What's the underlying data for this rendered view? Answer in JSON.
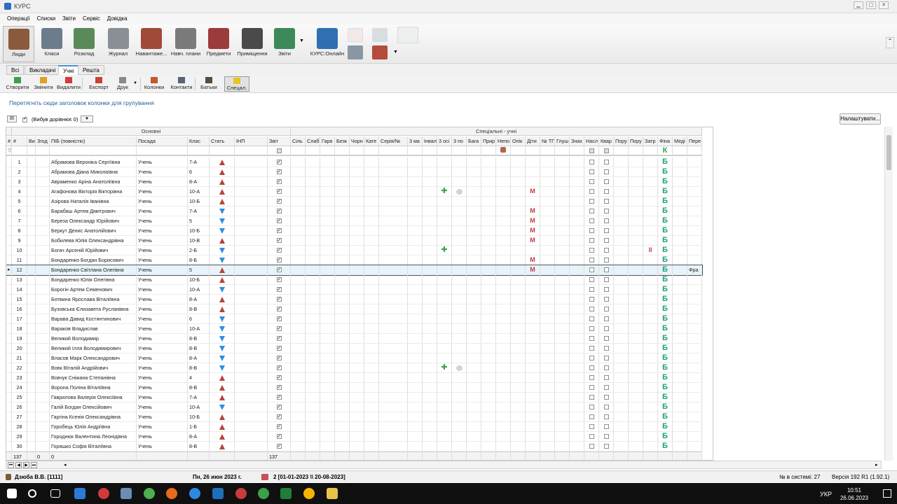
{
  "app": {
    "title": "КУРС"
  },
  "menu": [
    "Операції",
    "Списки",
    "Звіти",
    "Сервіс",
    "Довідка"
  ],
  "ribbon": {
    "buttons": [
      {
        "label": "Люди",
        "icon": "people-icon",
        "color": "#8a5a3c"
      },
      {
        "label": "Класи",
        "icon": "classroom-icon",
        "color": "#6c7c8c"
      },
      {
        "label": "Розклад",
        "icon": "schedule-icon",
        "color": "#5a8a5a"
      },
      {
        "label": "Журнал",
        "icon": "journal-icon",
        "color": "#8a8f96"
      },
      {
        "label": "Навантаже...",
        "icon": "calendar-icon",
        "color": "#a04a3a"
      },
      {
        "label": "Навч. плани",
        "icon": "plans-icon",
        "color": "#7a7a7a"
      },
      {
        "label": "Предмети",
        "icon": "book-icon",
        "color": "#9c3b3b"
      },
      {
        "label": "Приміщення",
        "icon": "building-icon",
        "color": "#4a4a4a"
      },
      {
        "label": "Звіти",
        "icon": "chart-icon",
        "color": "#3c8a5a"
      },
      {
        "label": "КУРС:Онлайн",
        "icon": "globe-icon",
        "color": "#2f6fb2"
      }
    ]
  },
  "tabs": [
    "Всі",
    "Викладачі",
    "Учні",
    "Решта"
  ],
  "active_tab": "Учні",
  "toolbar": {
    "buttons": [
      "Створити",
      "Змінити",
      "Видалити",
      "Експорт",
      "Друк",
      "Колонки",
      "Контакти",
      "Батьки",
      "Спецал."
    ]
  },
  "group_hint": "Перетягніть сюди заголовок колонки для групування",
  "filter_label": "(Вибув дорівнює 0)",
  "settings_button": "Налаштувати...",
  "grid": {
    "bands": {
      "main": "Основні",
      "special": "Спеціальні - учні"
    },
    "headers": [
      "#",
      "#",
      "Ви",
      "Згод",
      "ПІБ (повністю)",
      "Посада",
      "Клас",
      "Стать",
      "ІНП",
      "Звіт",
      "Сіль",
      "Слаб",
      "Гаря",
      "Безк",
      "Чорн",
      "Кате",
      "Серія/№",
      "3 ма",
      "Інвал",
      "3 осі",
      "3 по",
      "Бага",
      "Прир",
      "Непо",
      "Опік",
      "Діти",
      "№ ТГ",
      "Глуш",
      "Знах",
      "Насл",
      "Квар",
      "Пору",
      "Пору",
      "Затр",
      "Фіна",
      "Меді",
      "Пере"
    ],
    "rows": [
      {
        "n": "1",
        "name": "Абрамова Вероніка Сергіївна",
        "pos": "Учень",
        "cls": "7-А",
        "sex": "f",
        "rep": true,
        "mark": "",
        "grade": "Б"
      },
      {
        "n": "2",
        "name": "Абрамова Діана Миколаївна",
        "pos": "Учень",
        "cls": "6",
        "sex": "f",
        "rep": true,
        "mark": "",
        "grade": "Б"
      },
      {
        "n": "3",
        "name": "Авраменко Аріна Анатоліївна",
        "pos": "Учень",
        "cls": "8-А",
        "sex": "f",
        "rep": true,
        "mark": "",
        "grade": "Б"
      },
      {
        "n": "4",
        "name": "Агафонова Вікторія Вікторівна",
        "pos": "Учень",
        "cls": "10-А",
        "sex": "f",
        "rep": true,
        "mark": "plus-blob-m",
        "grade": "Б"
      },
      {
        "n": "5",
        "name": "Азірова Наталія Іванівна",
        "pos": "Учень",
        "cls": "10-Б",
        "sex": "f",
        "rep": true,
        "mark": "",
        "grade": "Б"
      },
      {
        "n": "6",
        "name": "Барабаш Артем Дмитрович",
        "pos": "Учень",
        "cls": "7-А",
        "sex": "m",
        "rep": true,
        "mark": "m",
        "grade": "Б"
      },
      {
        "n": "7",
        "name": "Береза Олександр Юрійович",
        "pos": "Учень",
        "cls": "5",
        "sex": "m",
        "rep": true,
        "mark": "m",
        "grade": "Б"
      },
      {
        "n": "8",
        "name": "Беркут Денис Анатолійович",
        "pos": "Учень",
        "cls": "10-Б",
        "sex": "m",
        "rep": true,
        "mark": "m",
        "grade": "Б"
      },
      {
        "n": "9",
        "name": "Бобилева Юлія Олександрівна",
        "pos": "Учень",
        "cls": "10-В",
        "sex": "f",
        "rep": true,
        "mark": "m",
        "grade": "Б"
      },
      {
        "n": "10",
        "name": "Богач Арсеній Юрійович",
        "pos": "Учень",
        "cls": "2-Б",
        "sex": "m",
        "rep": true,
        "mark": "plus-ii",
        "grade": "Б"
      },
      {
        "n": "11",
        "name": "Бондаренко Богдан Борисович",
        "pos": "Учень",
        "cls": "8-Б",
        "sex": "m",
        "rep": true,
        "mark": "m",
        "grade": "Б"
      },
      {
        "n": "12",
        "name": "Бондаренко Світлана Олегівна",
        "pos": "Учень",
        "cls": "5",
        "sex": "f",
        "rep": true,
        "mark": "m",
        "grade": "Б",
        "extra": "Фра",
        "sel": true
      },
      {
        "n": "13",
        "name": "Бондаренко Юлія Олегівна",
        "pos": "Учень",
        "cls": "10-Б",
        "sex": "f",
        "rep": true,
        "mark": "",
        "grade": "Б"
      },
      {
        "n": "14",
        "name": "Борогін Артем Семенович",
        "pos": "Учень",
        "cls": "10-А",
        "sex": "m",
        "rep": true,
        "mark": "",
        "grade": "Б"
      },
      {
        "n": "15",
        "name": "Ботвина Ярослава Віталіївна",
        "pos": "Учень",
        "cls": "8-А",
        "sex": "f",
        "rep": true,
        "mark": "",
        "grade": "Б"
      },
      {
        "n": "16",
        "name": "Бузовська Єлизавета Русланівна",
        "pos": "Учень",
        "cls": "8-В",
        "sex": "f",
        "rep": true,
        "mark": "",
        "grade": "Б"
      },
      {
        "n": "17",
        "name": "Варава Давид Костянтинович",
        "pos": "Учень",
        "cls": "6",
        "sex": "m",
        "rep": true,
        "mark": "",
        "grade": "Б"
      },
      {
        "n": "18",
        "name": "Вараков Владислав",
        "pos": "Учень",
        "cls": "10-А",
        "sex": "m",
        "rep": true,
        "mark": "",
        "grade": "Б"
      },
      {
        "n": "19",
        "name": "Великий Володимир",
        "pos": "Учень",
        "cls": "8-В",
        "sex": "m",
        "rep": true,
        "mark": "",
        "grade": "Б"
      },
      {
        "n": "20",
        "name": "Великий Ілля Володимирович",
        "pos": "Учень",
        "cls": "8-В",
        "sex": "m",
        "rep": true,
        "mark": "",
        "grade": "Б"
      },
      {
        "n": "21",
        "name": "Власов Марк Олександрович",
        "pos": "Учень",
        "cls": "8-А",
        "sex": "m",
        "rep": true,
        "mark": "",
        "grade": "Б"
      },
      {
        "n": "22",
        "name": "Вовк Віталій Андрійович",
        "pos": "Учень",
        "cls": "8-В",
        "sex": "m",
        "rep": true,
        "mark": "plus-blob",
        "grade": "Б"
      },
      {
        "n": "23",
        "name": "Вовчук Сніжана Степанівна",
        "pos": "Учень",
        "cls": "4",
        "sex": "f",
        "rep": true,
        "mark": "",
        "grade": "Б"
      },
      {
        "n": "24",
        "name": "Ворона Поліна Віталіївна",
        "pos": "Учень",
        "cls": "8-В",
        "sex": "f",
        "rep": true,
        "mark": "",
        "grade": "Б"
      },
      {
        "n": "25",
        "name": "Гаврилова Валерія Олексіївна",
        "pos": "Учень",
        "cls": "7-А",
        "sex": "f",
        "rep": true,
        "mark": "",
        "grade": "Б"
      },
      {
        "n": "26",
        "name": "Галій Богдан Олексійович",
        "pos": "Учень",
        "cls": "10-А",
        "sex": "m",
        "rep": true,
        "mark": "",
        "grade": "Б"
      },
      {
        "n": "27",
        "name": "Гаргіна Ксенія Олександрівна",
        "pos": "Учень",
        "cls": "10-Б",
        "sex": "f",
        "rep": true,
        "mark": "",
        "grade": "Б"
      },
      {
        "n": "28",
        "name": "Горобець Юлія Андріївна",
        "pos": "Учень",
        "cls": "1-Б",
        "sex": "f",
        "rep": true,
        "mark": "",
        "grade": "Б"
      },
      {
        "n": "29",
        "name": "Городнюк Валентина Леонідівна",
        "pos": "Учень",
        "cls": "8-А",
        "sex": "f",
        "rep": true,
        "mark": "",
        "grade": "Б"
      },
      {
        "n": "30",
        "name": "Горяшко Софія Віталіївна",
        "pos": "Учень",
        "cls": "8-В",
        "sex": "f",
        "rep": true,
        "mark": "",
        "grade": "Б"
      }
    ],
    "footer": {
      "count": "137",
      "zero1": "0",
      "zero2": "0",
      "report_count": "137"
    }
  },
  "filter_grade": "К",
  "status": {
    "user": "Дзюба В.В. [1111]",
    "date": "Пн, 26 июн 2023 г.",
    "period": "2 [01-01-2023 \\\\ 20-08-2023]",
    "system_count": "№ в системі: 27",
    "version": "Версія 192 R1 (1.92.1)"
  },
  "tray": {
    "lang": "УКР",
    "time": "10:51",
    "date": "26.06.2023"
  }
}
